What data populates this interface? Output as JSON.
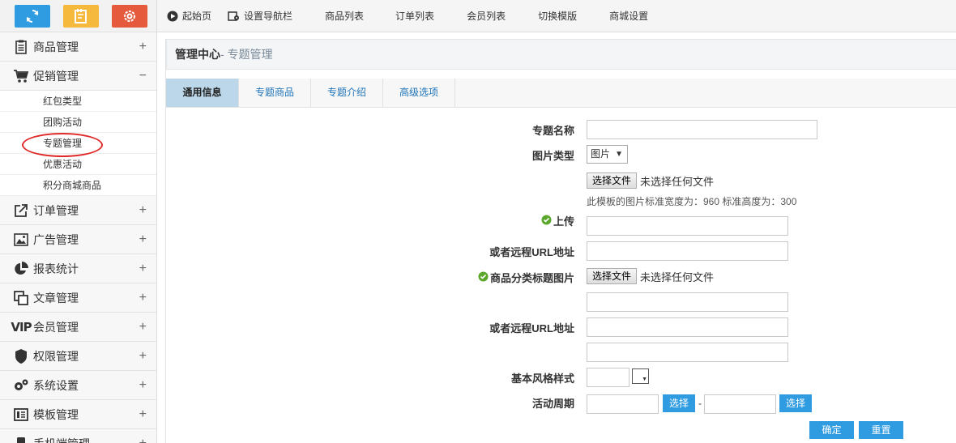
{
  "topnav": {
    "home": "起始页",
    "nav_settings": "设置导航栏",
    "goods_list": "商品列表",
    "order_list": "订单列表",
    "member_list": "会员列表",
    "switch_template": "切换模版",
    "mall_settings": "商城设置"
  },
  "sidebar": {
    "items": [
      {
        "label": "商品管理",
        "toggle": "+"
      },
      {
        "label": "促销管理",
        "toggle": "−"
      },
      {
        "label": "订单管理",
        "toggle": "+"
      },
      {
        "label": "广告管理",
        "toggle": "+"
      },
      {
        "label": "报表统计",
        "toggle": "+"
      },
      {
        "label": "文章管理",
        "toggle": "+"
      },
      {
        "label": "会员管理",
        "toggle": "+"
      },
      {
        "label": "权限管理",
        "toggle": "+"
      },
      {
        "label": "系统设置",
        "toggle": "+"
      },
      {
        "label": "模板管理",
        "toggle": "+"
      },
      {
        "label": "手机端管理",
        "toggle": "+"
      }
    ],
    "promo_sub": [
      "红包类型",
      "团购活动",
      "专题管理",
      "优惠活动",
      "积分商城商品"
    ]
  },
  "header": {
    "main": "管理中心",
    "sub": "- 专题管理"
  },
  "tabs": [
    "通用信息",
    "专题商品",
    "专题介绍",
    "高级选项"
  ],
  "form": {
    "topic_name_label": "专题名称",
    "image_type_label": "图片类型",
    "image_type_value": "图片",
    "upload_label": "上传",
    "choose_file": "选择文件",
    "no_file": "未选择任何文件",
    "hint": "此模板的图片标准宽度为：960 标准高度为：300",
    "remote_url_label": "或者远程URL地址",
    "category_title_label": "商品分类标题图片",
    "style_label": "基本风格样式",
    "period_label": "活动周期",
    "select_btn": "选择",
    "dash": "-",
    "confirm": "确定",
    "reset": "重置"
  }
}
